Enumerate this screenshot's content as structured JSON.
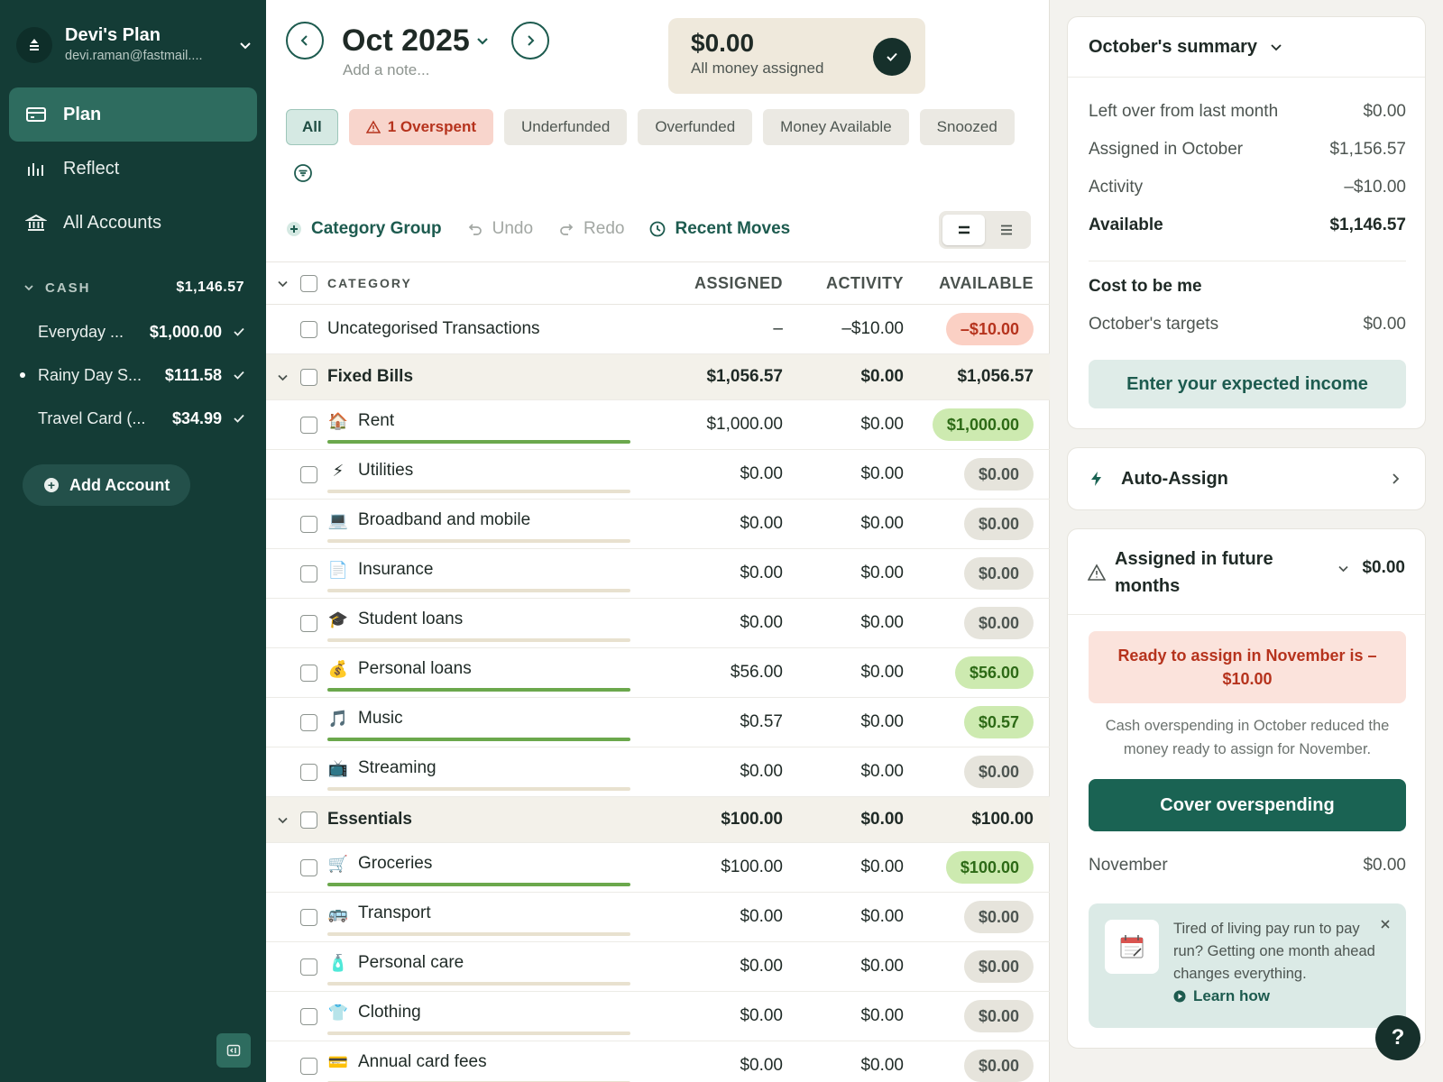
{
  "plan": {
    "name": "Devi's Plan",
    "email": "devi.raman@fastmail...."
  },
  "nav": {
    "plan": "Plan",
    "reflect": "Reflect",
    "accounts": "All Accounts"
  },
  "account_group": {
    "label": "CASH",
    "total": "$1,146.57"
  },
  "accounts": [
    {
      "name": "Everyday ...",
      "balance": "$1,000.00"
    },
    {
      "name": "Rainy Day S...",
      "balance": "$111.58"
    },
    {
      "name": "Travel Card (...",
      "balance": "$34.99"
    }
  ],
  "add_account": "Add Account",
  "month": {
    "title": "Oct 2025",
    "note_placeholder": "Add a note..."
  },
  "ready_to_assign": {
    "amount": "$0.00",
    "label": "All money assigned"
  },
  "filters": [
    "All",
    "1 Overspent",
    "Underfunded",
    "Overfunded",
    "Money Available",
    "Snoozed"
  ],
  "toolbar": {
    "category_group": "Category Group",
    "undo": "Undo",
    "redo": "Redo",
    "recent_moves": "Recent Moves"
  },
  "table": {
    "headers": {
      "category": "CATEGORY",
      "assigned": "ASSIGNED",
      "activity": "ACTIVITY",
      "available": "AVAILABLE"
    },
    "uncategorised": {
      "name": "Uncategorised Transactions",
      "assigned": "–",
      "activity": "–$10.00",
      "available": "–$10.00"
    },
    "groups": [
      {
        "name": "Fixed Bills",
        "assigned": "$1,056.57",
        "activity": "$0.00",
        "available": "$1,056.57",
        "rows": [
          {
            "emoji": "🏠",
            "name": "Rent",
            "assigned": "$1,000.00",
            "activity": "$0.00",
            "available": "$1,000.00",
            "status": "green",
            "progress": 1
          },
          {
            "emoji": "⚡",
            "name": "Utilities",
            "assigned": "$0.00",
            "activity": "$0.00",
            "available": "$0.00",
            "status": "zero",
            "progress": 0
          },
          {
            "emoji": "💻",
            "name": "Broadband and mobile",
            "assigned": "$0.00",
            "activity": "$0.00",
            "available": "$0.00",
            "status": "zero",
            "progress": 0
          },
          {
            "emoji": "📄",
            "name": "Insurance",
            "assigned": "$0.00",
            "activity": "$0.00",
            "available": "$0.00",
            "status": "zero",
            "progress": 0
          },
          {
            "emoji": "🎓",
            "name": "Student loans",
            "assigned": "$0.00",
            "activity": "$0.00",
            "available": "$0.00",
            "status": "zero",
            "progress": 0
          },
          {
            "emoji": "💰",
            "name": "Personal loans",
            "assigned": "$56.00",
            "activity": "$0.00",
            "available": "$56.00",
            "status": "green",
            "progress": 1
          },
          {
            "emoji": "🎵",
            "name": "Music",
            "assigned": "$0.57",
            "activity": "$0.00",
            "available": "$0.57",
            "status": "green",
            "progress": 1
          },
          {
            "emoji": "📺",
            "name": "Streaming",
            "assigned": "$0.00",
            "activity": "$0.00",
            "available": "$0.00",
            "status": "zero",
            "progress": 0
          }
        ]
      },
      {
        "name": "Essentials",
        "assigned": "$100.00",
        "activity": "$0.00",
        "available": "$100.00",
        "rows": [
          {
            "emoji": "🛒",
            "name": "Groceries",
            "assigned": "$100.00",
            "activity": "$0.00",
            "available": "$100.00",
            "status": "green",
            "progress": 1
          },
          {
            "emoji": "🚌",
            "name": "Transport",
            "assigned": "$0.00",
            "activity": "$0.00",
            "available": "$0.00",
            "status": "zero",
            "progress": 0
          },
          {
            "emoji": "🧴",
            "name": "Personal care",
            "assigned": "$0.00",
            "activity": "$0.00",
            "available": "$0.00",
            "status": "zero",
            "progress": 0
          },
          {
            "emoji": "👕",
            "name": "Clothing",
            "assigned": "$0.00",
            "activity": "$0.00",
            "available": "$0.00",
            "status": "zero",
            "progress": 0
          },
          {
            "emoji": "💳",
            "name": "Annual card fees",
            "assigned": "$0.00",
            "activity": "$0.00",
            "available": "$0.00",
            "status": "zero",
            "progress": 0
          }
        ]
      }
    ]
  },
  "summary": {
    "title": "October's summary",
    "items": [
      {
        "label": "Left over from last month",
        "value": "$0.00"
      },
      {
        "label": "Assigned in October",
        "value": "$1,156.57"
      },
      {
        "label": "Activity",
        "value": "–$10.00"
      },
      {
        "label": "Available",
        "value": "$1,146.57"
      }
    ],
    "cost_title": "Cost to be me",
    "targets_label": "October's targets",
    "targets_value": "$0.00",
    "income_button": "Enter your expected income"
  },
  "auto_assign": "Auto-Assign",
  "future": {
    "title": "Assigned in future months",
    "amount": "$0.00",
    "alert": "Ready to assign in November is –$10.00",
    "explain": "Cash overspending in October reduced the money ready to assign for November.",
    "cover_button": "Cover overspending",
    "next_label": "November",
    "next_value": "$0.00"
  },
  "tip": {
    "text": "Tired of living pay run to pay run? Getting one month ahead changes everything.",
    "link": "Learn how"
  },
  "help": "?",
  "colors": {
    "sidebar": "#143c36",
    "brand": "#1a6353",
    "overspent": "#b6331d",
    "funded": "#cdeab0"
  }
}
